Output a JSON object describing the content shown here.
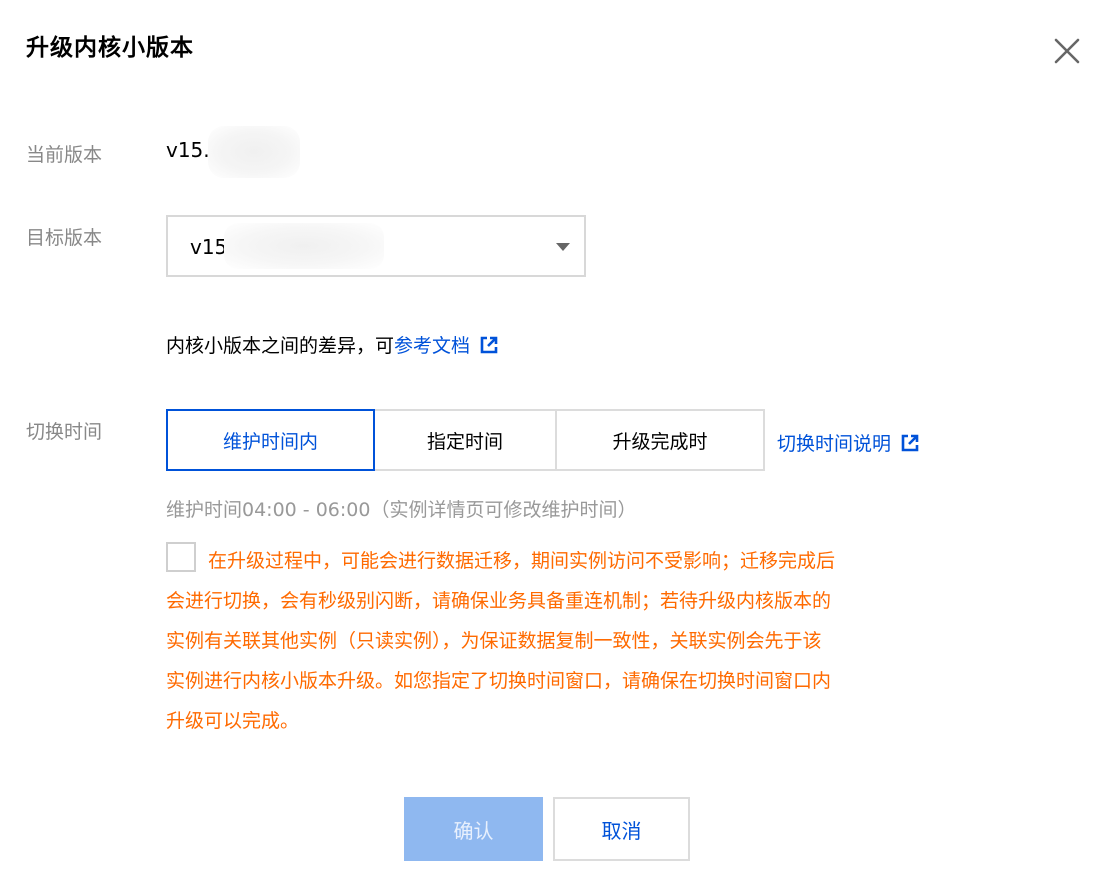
{
  "dialog": {
    "title": "升级内核小版本"
  },
  "current_version": {
    "label": "当前版本",
    "value": "v15."
  },
  "target_version": {
    "label": "目标版本",
    "value": "v15"
  },
  "hint": {
    "text": "内核小版本之间的差异，可",
    "link": "参考文档"
  },
  "switch_time": {
    "label": "切换时间",
    "options": [
      "维护时间内",
      "指定时间",
      "升级完成时"
    ],
    "selected_index": 0,
    "help_link": "切换时间说明",
    "maintenance_note": "维护时间04:00 - 06:00（实例详情页可修改维护时间）"
  },
  "warning": {
    "checked": false,
    "lines": [
      "在升级过程中，可能会进行数据迁移，期间实例访问不受影响；迁移完成后",
      "会进行切换，会有秒级别闪断，请确保业务具备重连机制；若待升级内核版本的",
      "实例有关联其他实例（只读实例），为保证数据复制一致性，关联实例会先于该",
      "实例进行内核小版本升级。如您指定了切换时间窗口，请确保在切换时间窗口内",
      "升级可以完成。"
    ]
  },
  "footer": {
    "confirm_label": "确认",
    "cancel_label": "取消"
  },
  "colors": {
    "primary": "#0052d9",
    "warning": "#ff6a00",
    "confirm_disabled": "#8fb8f0"
  },
  "icons": [
    "close-icon",
    "chevron-down-icon",
    "external-link-icon"
  ]
}
